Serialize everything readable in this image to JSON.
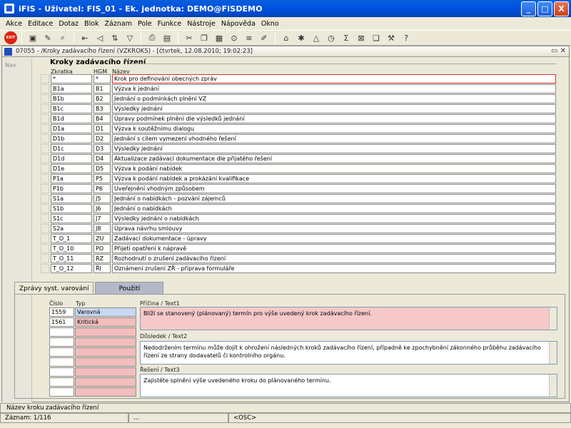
{
  "window": {
    "title": "iFIS - Uživatel: FIS_01 - Ek. jednotka: DEMO@FISDEMO",
    "minimize": "_",
    "maximize": "□",
    "close": "X"
  },
  "menu": [
    "Akce",
    "Editace",
    "Dotaz",
    "Blok",
    "Záznam",
    "Pole",
    "Funkce",
    "Nástroje",
    "Nápověda",
    "Okno"
  ],
  "toolbar": {
    "exit_label": "EXIT",
    "icons": [
      "save-icon",
      "print-icon",
      "cut-icon",
      "copy-icon",
      "paste-icon",
      "filter-icon",
      "sort-icon",
      "calendar-icon",
      "sum-icon",
      "excel-icon",
      "help-icon"
    ]
  },
  "form": {
    "title": "07055 - /Kroky zadávacího řízení (VZKROKS) - [čtvrtek, 12.08.2010; 19:02:23]",
    "nav_label": "Nav",
    "window_controls": "▭ ✕",
    "section_title": "Kroky zadávacího řízení",
    "col_zkratka": "Zkratka",
    "col_hgm": "HGM",
    "col_nazev": "Název",
    "steps": [
      {
        "zkratka": "*",
        "hgm": "*",
        "nazev": "Krok pro definování obecných zpráv"
      },
      {
        "zkratka": "B1a",
        "hgm": "B1",
        "nazev": "Výzva k jednání"
      },
      {
        "zkratka": "B1b",
        "hgm": "B2",
        "nazev": "Jednání o podmínkách plnění VZ"
      },
      {
        "zkratka": "B1c",
        "hgm": "B3",
        "nazev": "Výsledky jednání"
      },
      {
        "zkratka": "B1d",
        "hgm": "B4",
        "nazev": "Úpravy podmínek plnění dle výsledků jednání"
      },
      {
        "zkratka": "D1a",
        "hgm": "D1",
        "nazev": "Výzva k soutěžnímu dialogu"
      },
      {
        "zkratka": "D1b",
        "hgm": "D2",
        "nazev": "Jednání s cílem vymezení vhodného řešení"
      },
      {
        "zkratka": "D1c",
        "hgm": "D3",
        "nazev": "Výsledky jednání"
      },
      {
        "zkratka": "D1d",
        "hgm": "D4",
        "nazev": "Aktualizace zadávací dokumentace dle přijatého řešení"
      },
      {
        "zkratka": "D1e",
        "hgm": "D5",
        "nazev": "Výzva k podání nabídek"
      },
      {
        "zkratka": "P1a",
        "hgm": "P5",
        "nazev": "Výzva k podání nabídek a prokázání kvalifikace"
      },
      {
        "zkratka": "P1b",
        "hgm": "P6",
        "nazev": "Uveřejnění vhodným způsobem"
      },
      {
        "zkratka": "S1a",
        "hgm": "J5",
        "nazev": "Jednání o nabídkách - pozvání zájemců"
      },
      {
        "zkratka": "S1b",
        "hgm": "J6",
        "nazev": "Jednání o nabídkách"
      },
      {
        "zkratka": "S1c",
        "hgm": "J7",
        "nazev": "Výsledky jednání o nabídkách"
      },
      {
        "zkratka": "S2a",
        "hgm": "J8",
        "nazev": "Úprava návrhu smlouvy"
      },
      {
        "zkratka": "T_O_1",
        "hgm": "ZU",
        "nazev": "Zadávací dokumentace - úpravy"
      },
      {
        "zkratka": "T_O_10",
        "hgm": "PO",
        "nazev": "Přijetí opatření k nápravě"
      },
      {
        "zkratka": "T_O_11",
        "hgm": "RZ",
        "nazev": "Rozhodnutí o zrušení zadávacího řízení"
      },
      {
        "zkratka": "T_O_12",
        "hgm": "ŘI",
        "nazev": "Oznámení zrušení ZŘ - příprava formuláře"
      }
    ],
    "tabs": {
      "active": "Zprávy syst. varování",
      "inactive": "Použití"
    },
    "messages": {
      "col_cislo": "Číslo",
      "col_typ": "Typ",
      "rows": [
        {
          "cislo": "1559",
          "typ": "Varovná"
        },
        {
          "cislo": "1561",
          "typ": "Kritická"
        }
      ],
      "empty_rows": 7
    },
    "pricina_label": "Příčina / Text1",
    "pricina_text": "Blíží se stanovený (plánovaný) termín pro výše uvedený krok zadávacího řízení.",
    "dusledek_label": "Důsledek / Text2",
    "dusledek_text": "Nedodržením termínu může dojít k ohrožení následných kroků zadávacího řízení, případně ke zpochybnění zákonného průběhu zadávacího řízení ze strany dodavatelů či kontrolního orgánu.",
    "reseni_label": "Řešení / Text3",
    "reseni_text": "Zajistěte splnění výše uvedeného kroku do plánovaného termínu."
  },
  "status": {
    "hint": "Název kroku zadávacího řízení",
    "record": "Záznam: 1/116",
    "dots": "...",
    "osc": "<OSC>"
  }
}
